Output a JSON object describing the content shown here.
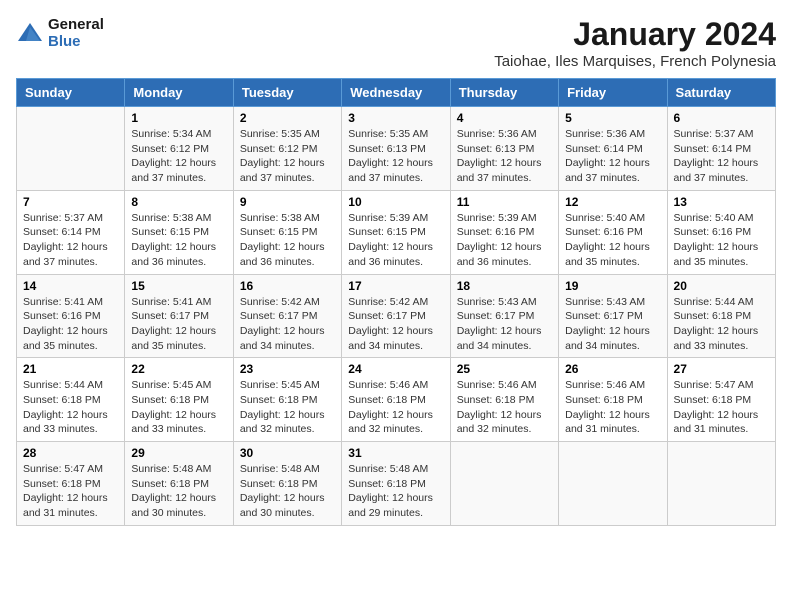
{
  "header": {
    "logo_line1": "General",
    "logo_line2": "Blue",
    "title": "January 2024",
    "subtitle": "Taiohae, Iles Marquises, French Polynesia"
  },
  "weekdays": [
    "Sunday",
    "Monday",
    "Tuesday",
    "Wednesday",
    "Thursday",
    "Friday",
    "Saturday"
  ],
  "weeks": [
    [
      {
        "day": "",
        "info": ""
      },
      {
        "day": "1",
        "info": "Sunrise: 5:34 AM\nSunset: 6:12 PM\nDaylight: 12 hours\nand 37 minutes."
      },
      {
        "day": "2",
        "info": "Sunrise: 5:35 AM\nSunset: 6:12 PM\nDaylight: 12 hours\nand 37 minutes."
      },
      {
        "day": "3",
        "info": "Sunrise: 5:35 AM\nSunset: 6:13 PM\nDaylight: 12 hours\nand 37 minutes."
      },
      {
        "day": "4",
        "info": "Sunrise: 5:36 AM\nSunset: 6:13 PM\nDaylight: 12 hours\nand 37 minutes."
      },
      {
        "day": "5",
        "info": "Sunrise: 5:36 AM\nSunset: 6:14 PM\nDaylight: 12 hours\nand 37 minutes."
      },
      {
        "day": "6",
        "info": "Sunrise: 5:37 AM\nSunset: 6:14 PM\nDaylight: 12 hours\nand 37 minutes."
      }
    ],
    [
      {
        "day": "7",
        "info": "Sunrise: 5:37 AM\nSunset: 6:14 PM\nDaylight: 12 hours\nand 37 minutes."
      },
      {
        "day": "8",
        "info": "Sunrise: 5:38 AM\nSunset: 6:15 PM\nDaylight: 12 hours\nand 36 minutes."
      },
      {
        "day": "9",
        "info": "Sunrise: 5:38 AM\nSunset: 6:15 PM\nDaylight: 12 hours\nand 36 minutes."
      },
      {
        "day": "10",
        "info": "Sunrise: 5:39 AM\nSunset: 6:15 PM\nDaylight: 12 hours\nand 36 minutes."
      },
      {
        "day": "11",
        "info": "Sunrise: 5:39 AM\nSunset: 6:16 PM\nDaylight: 12 hours\nand 36 minutes."
      },
      {
        "day": "12",
        "info": "Sunrise: 5:40 AM\nSunset: 6:16 PM\nDaylight: 12 hours\nand 35 minutes."
      },
      {
        "day": "13",
        "info": "Sunrise: 5:40 AM\nSunset: 6:16 PM\nDaylight: 12 hours\nand 35 minutes."
      }
    ],
    [
      {
        "day": "14",
        "info": "Sunrise: 5:41 AM\nSunset: 6:16 PM\nDaylight: 12 hours\nand 35 minutes."
      },
      {
        "day": "15",
        "info": "Sunrise: 5:41 AM\nSunset: 6:17 PM\nDaylight: 12 hours\nand 35 minutes."
      },
      {
        "day": "16",
        "info": "Sunrise: 5:42 AM\nSunset: 6:17 PM\nDaylight: 12 hours\nand 34 minutes."
      },
      {
        "day": "17",
        "info": "Sunrise: 5:42 AM\nSunset: 6:17 PM\nDaylight: 12 hours\nand 34 minutes."
      },
      {
        "day": "18",
        "info": "Sunrise: 5:43 AM\nSunset: 6:17 PM\nDaylight: 12 hours\nand 34 minutes."
      },
      {
        "day": "19",
        "info": "Sunrise: 5:43 AM\nSunset: 6:17 PM\nDaylight: 12 hours\nand 34 minutes."
      },
      {
        "day": "20",
        "info": "Sunrise: 5:44 AM\nSunset: 6:18 PM\nDaylight: 12 hours\nand 33 minutes."
      }
    ],
    [
      {
        "day": "21",
        "info": "Sunrise: 5:44 AM\nSunset: 6:18 PM\nDaylight: 12 hours\nand 33 minutes."
      },
      {
        "day": "22",
        "info": "Sunrise: 5:45 AM\nSunset: 6:18 PM\nDaylight: 12 hours\nand 33 minutes."
      },
      {
        "day": "23",
        "info": "Sunrise: 5:45 AM\nSunset: 6:18 PM\nDaylight: 12 hours\nand 32 minutes."
      },
      {
        "day": "24",
        "info": "Sunrise: 5:46 AM\nSunset: 6:18 PM\nDaylight: 12 hours\nand 32 minutes."
      },
      {
        "day": "25",
        "info": "Sunrise: 5:46 AM\nSunset: 6:18 PM\nDaylight: 12 hours\nand 32 minutes."
      },
      {
        "day": "26",
        "info": "Sunrise: 5:46 AM\nSunset: 6:18 PM\nDaylight: 12 hours\nand 31 minutes."
      },
      {
        "day": "27",
        "info": "Sunrise: 5:47 AM\nSunset: 6:18 PM\nDaylight: 12 hours\nand 31 minutes."
      }
    ],
    [
      {
        "day": "28",
        "info": "Sunrise: 5:47 AM\nSunset: 6:18 PM\nDaylight: 12 hours\nand 31 minutes."
      },
      {
        "day": "29",
        "info": "Sunrise: 5:48 AM\nSunset: 6:18 PM\nDaylight: 12 hours\nand 30 minutes."
      },
      {
        "day": "30",
        "info": "Sunrise: 5:48 AM\nSunset: 6:18 PM\nDaylight: 12 hours\nand 30 minutes."
      },
      {
        "day": "31",
        "info": "Sunrise: 5:48 AM\nSunset: 6:18 PM\nDaylight: 12 hours\nand 29 minutes."
      },
      {
        "day": "",
        "info": ""
      },
      {
        "day": "",
        "info": ""
      },
      {
        "day": "",
        "info": ""
      }
    ]
  ]
}
